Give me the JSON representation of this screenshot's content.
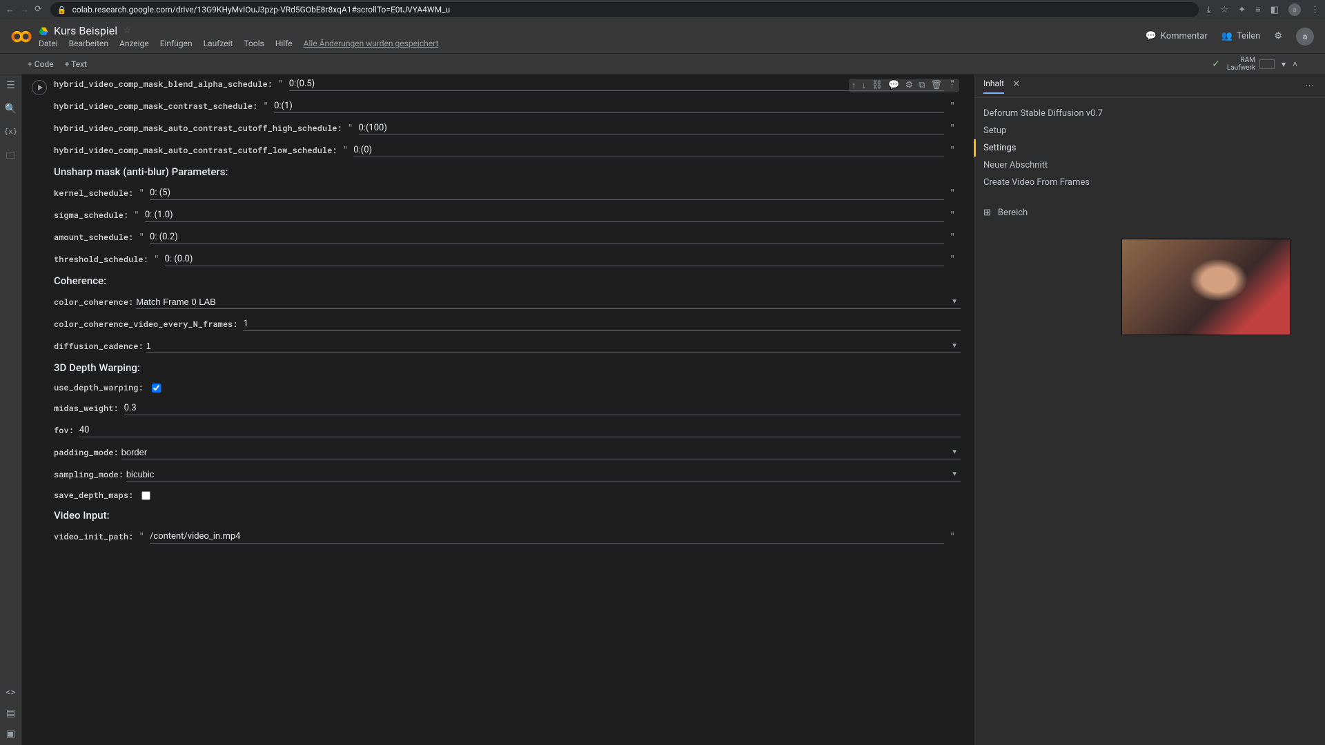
{
  "browser": {
    "url": "colab.research.google.com/drive/13G9KHyMvIOuJ3pzp-VRd5GObE8r8xqA1#scrollTo=E0tJVYA4WM_u",
    "avatar": "a"
  },
  "header": {
    "title": "Kurs Beispiel",
    "menus": [
      "Datei",
      "Bearbeiten",
      "Anzeige",
      "Einfügen",
      "Laufzeit",
      "Tools",
      "Hilfe"
    ],
    "saved": "Alle Änderungen wurden gespeichert",
    "kommentar": "Kommentar",
    "teilen": "Teilen",
    "avatar": "a"
  },
  "toolbar": {
    "code": "+ Code",
    "text": "+ Text",
    "ram": "RAM",
    "laufwerk": "Laufwerk"
  },
  "form": {
    "rows": [
      {
        "label": "hybrid_video_comp_mask_blend_alpha_schedule:",
        "type": "text",
        "value": "0:(0.5)",
        "quoted": true
      },
      {
        "label": "hybrid_video_comp_mask_contrast_schedule:",
        "type": "text",
        "value": "0:(1)",
        "quoted": true
      },
      {
        "label": "hybrid_video_comp_mask_auto_contrast_cutoff_high_schedule:",
        "type": "text",
        "value": "0:(100)",
        "quoted": true
      },
      {
        "label": "hybrid_video_comp_mask_auto_contrast_cutoff_low_schedule:",
        "type": "text",
        "value": "0:(0)",
        "quoted": true
      }
    ],
    "h1": "Unsharp mask (anti-blur) Parameters:",
    "unsharp": [
      {
        "label": "kernel_schedule:",
        "type": "text",
        "value": "0: (5)",
        "quoted": true
      },
      {
        "label": "sigma_schedule:",
        "type": "text",
        "value": "0: (1.0)",
        "quoted": true
      },
      {
        "label": "amount_schedule:",
        "type": "text",
        "value": "0: (0.2)",
        "quoted": true
      },
      {
        "label": "threshold_schedule:",
        "type": "text",
        "value": "0: (0.0)",
        "quoted": true
      }
    ],
    "h2": "Coherence:",
    "coherence": [
      {
        "label": "color_coherence:",
        "type": "select",
        "value": "Match Frame 0 LAB"
      },
      {
        "label": "color_coherence_video_every_N_frames:",
        "type": "text",
        "value": "1",
        "quoted": false
      },
      {
        "label": "diffusion_cadence:",
        "type": "select",
        "value": "1"
      }
    ],
    "h3": "3D Depth Warping:",
    "depth": [
      {
        "label": "use_depth_warping:",
        "type": "check",
        "checked": true
      },
      {
        "label": "midas_weight:",
        "type": "text",
        "value": "0.3",
        "quoted": false
      },
      {
        "label": "fov:",
        "type": "text",
        "value": "40",
        "quoted": false
      },
      {
        "label": "padding_mode:",
        "type": "select",
        "value": "border"
      },
      {
        "label": "sampling_mode:",
        "type": "select",
        "value": "bicubic"
      },
      {
        "label": "save_depth_maps:",
        "type": "check",
        "checked": false
      }
    ],
    "h4": "Video Input:",
    "video": [
      {
        "label": "video_init_path:",
        "type": "text",
        "value": "/content/video_in.mp4",
        "quoted": true
      }
    ]
  },
  "toc": {
    "tab": "Inhalt",
    "items": [
      {
        "label": "Deforum Stable Diffusion v0.7",
        "active": false
      },
      {
        "label": "Setup",
        "active": false
      },
      {
        "label": "Settings",
        "active": true
      },
      {
        "label": "Neuer Abschnitt",
        "active": false
      },
      {
        "label": "Create Video From Frames",
        "active": false
      }
    ],
    "add": "Bereich"
  }
}
